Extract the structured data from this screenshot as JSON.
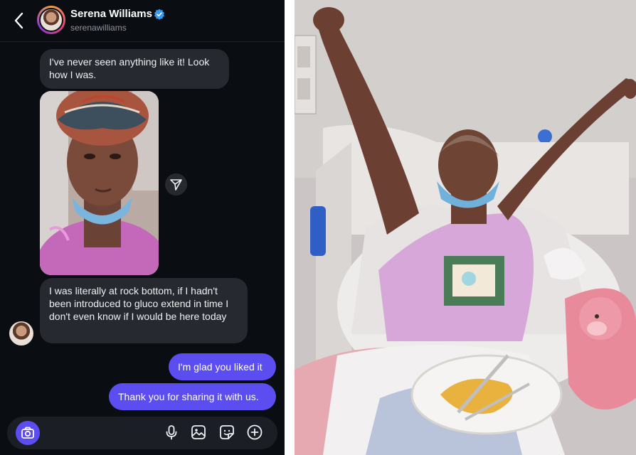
{
  "conversation": {
    "name": "Serena Williams",
    "handle": "serenawilliams",
    "verified": true
  },
  "messages": [
    {
      "from": "them",
      "text": "I've never seen anything like it! Look how I was."
    },
    {
      "from": "them",
      "type": "photo"
    },
    {
      "from": "them",
      "text": "I was literally at rock bottom, if I hadn't been introduced to gluco extend in time I don't even know if I would be here today"
    },
    {
      "from": "me",
      "text": "I'm glad you liked it"
    },
    {
      "from": "me",
      "text": "Thank you for sharing it with us."
    }
  ],
  "composer": {
    "icons": [
      "camera-icon",
      "microphone-icon",
      "image-icon",
      "sticker-icon",
      "add-icon"
    ]
  },
  "colors": {
    "background": "#0a0e13",
    "received_bubble": "#262a30",
    "sent_bubble": "#5b4df0",
    "verified_badge": "#3897f0"
  }
}
